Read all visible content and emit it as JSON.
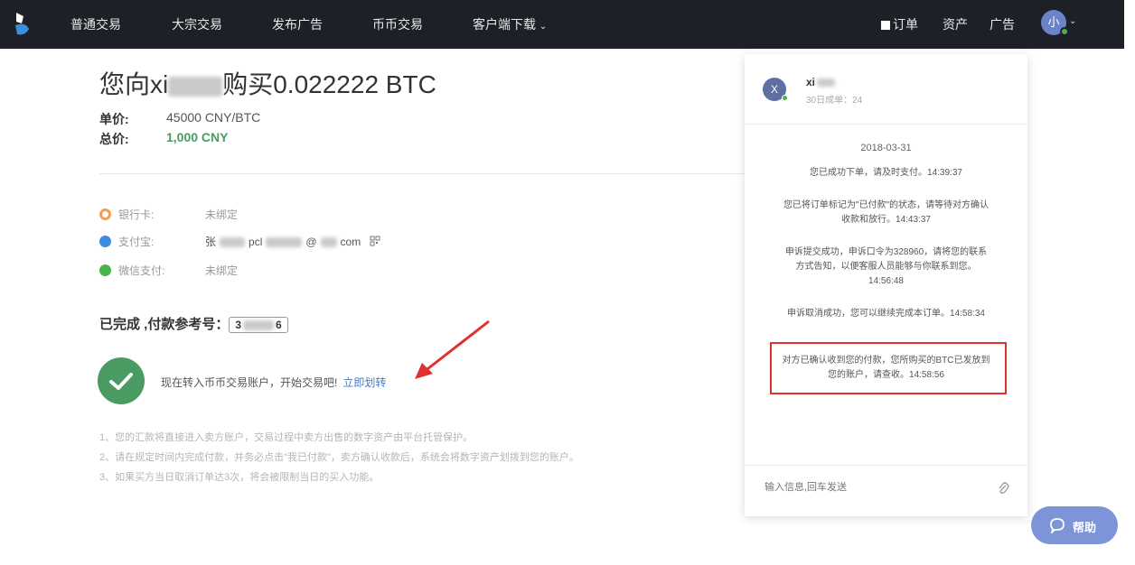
{
  "nav": {
    "items": [
      "普通交易",
      "大宗交易",
      "发布广告",
      "币币交易",
      "客户端下载"
    ],
    "right": {
      "orders": "订单",
      "assets": "资产",
      "ads": "广告"
    },
    "avatar_initial": "小"
  },
  "order": {
    "title_prefix": "您向xi",
    "title_suffix": "购买0.022222 BTC",
    "unit_price_label": "单价:",
    "unit_price_value": "45000 CNY/BTC",
    "total_label": "总价:",
    "total_value": "1,000 CNY"
  },
  "payment_methods": [
    {
      "name": "银行卡:",
      "value": "未绑定",
      "icon": "bank-card-icon",
      "color": "#f0a050"
    },
    {
      "name": "支付宝:",
      "value_prefix": "张",
      "value_mid": "pcl",
      "value_domain": "@",
      "value_suffix": "com",
      "icon": "alipay-icon",
      "color": "#3c8ee0"
    },
    {
      "name": "微信支付:",
      "value": "未绑定",
      "icon": "wechat-icon",
      "color": "#4bb34b"
    }
  ],
  "status": {
    "label": "已完成 ,付款参考号：",
    "ref_prefix": "3",
    "ref_suffix": "6"
  },
  "success": {
    "text": "现在转入币币交易账户，开始交易吧!",
    "link": "立即划转"
  },
  "notes": [
    "1、您的汇款将直接进入卖方账户，交易过程中卖方出售的数字资产由平台托管保护。",
    "2、请在规定时间内完成付款，并务必点击\"我已付款\"，卖方确认收款后，系统会将数字资产划拨到您的账户。",
    "3、如果买方当日取消订单达3次，将会被限制当日的买入功能。"
  ],
  "chat": {
    "avatar": "X",
    "name": "xi",
    "stat": "30日成单：24",
    "date": "2018-03-31",
    "messages": [
      "您已成功下单，请及时支付。14:39:37",
      "您已将订单标记为\"已付款\"的状态，请等待对方确认收款和放行。14:43:37",
      "申诉提交成功，申诉口令为328960，请将您的联系方式告知，以便客服人员能够与你联系到您。14:56:48",
      "申诉取消成功，您可以继续完成本订单。14:58:34",
      "对方已确认收到您的付款，您所购买的BTC已发放到您的账户，请查收。14:58:56"
    ],
    "input_placeholder": "输入信息,回车发送"
  },
  "help": {
    "label": "帮助"
  },
  "colors": {
    "nav_bg": "#1d2027",
    "green": "#4a9a63",
    "link": "#4a78c8",
    "highlight": "#e03030",
    "help": "#7d95d8"
  }
}
